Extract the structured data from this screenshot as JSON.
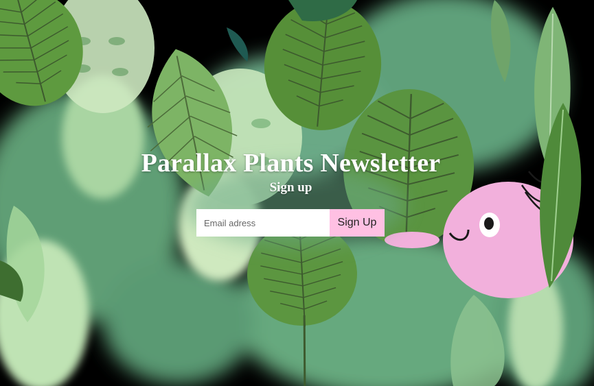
{
  "page": {
    "title": "Parallax Plants Newsletter",
    "subtitle": "Sign up"
  },
  "form": {
    "email_placeholder": "Email adress",
    "email_value": "",
    "submit_label": "Sign Up"
  },
  "colors": {
    "background": "#000000",
    "leaf_dark": "#4f8a3a",
    "leaf_mid": "#6aa86f",
    "leaf_light": "#bfe3b4",
    "mist_green": "#5fa07a",
    "creature_pink": "#f2b0dc",
    "button_pink": "#ffc0e3",
    "text_white": "#ffffff"
  },
  "icons": {
    "background": "jungle-leaves-illustration",
    "creature": "pink-creature-peeking"
  }
}
